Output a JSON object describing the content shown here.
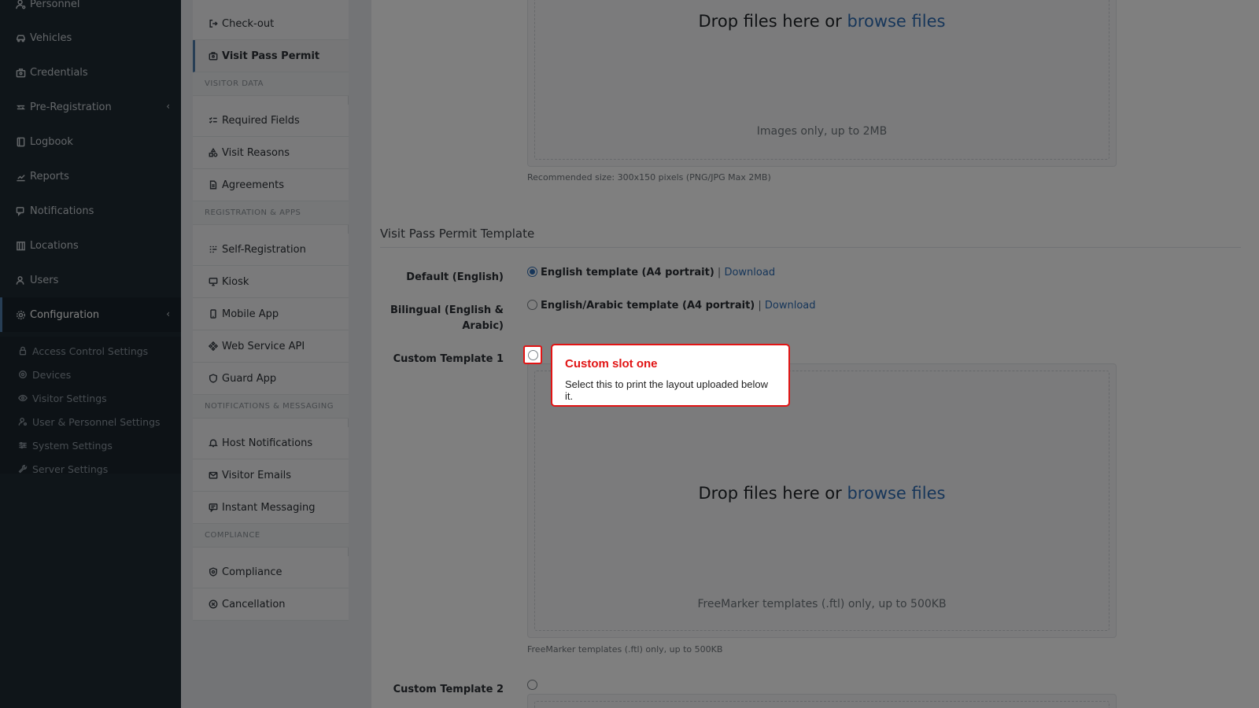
{
  "sidebar": {
    "items": [
      {
        "label": "Personnel",
        "icon": "user-cog-icon"
      },
      {
        "label": "Vehicles",
        "icon": "car-icon"
      },
      {
        "label": "Credentials",
        "icon": "id-card-icon"
      },
      {
        "label": "Pre-Registration",
        "icon": "arrows-icon"
      },
      {
        "label": "Logbook",
        "icon": "book-icon"
      },
      {
        "label": "Reports",
        "icon": "chart-icon"
      },
      {
        "label": "Notifications",
        "icon": "chat-icon"
      },
      {
        "label": "Locations",
        "icon": "building-icon"
      },
      {
        "label": "Users",
        "icon": "users-icon"
      },
      {
        "label": "Configuration",
        "icon": "gear-icon"
      }
    ],
    "config_sub": [
      {
        "label": "Access Control Settings",
        "icon": "lock-icon"
      },
      {
        "label": "Devices",
        "icon": "devices-icon"
      },
      {
        "label": "Visitor Settings",
        "icon": "eye-icon"
      },
      {
        "label": "User & Personnel Settings",
        "icon": "user-settings-icon"
      },
      {
        "label": "System Settings",
        "icon": "sliders-icon"
      },
      {
        "label": "Server Settings",
        "icon": "wrench-icon"
      }
    ]
  },
  "subnav": {
    "top_items": [
      {
        "label": "Check-out",
        "icon": "sign-out-icon"
      },
      {
        "label": "Visit Pass Permit",
        "icon": "id-badge-icon"
      }
    ],
    "sections": [
      {
        "title": "VISITOR DATA",
        "items": [
          {
            "label": "Required Fields",
            "icon": "checklist-icon"
          },
          {
            "label": "Visit Reasons",
            "icon": "shapes-icon"
          },
          {
            "label": "Agreements",
            "icon": "document-icon"
          }
        ]
      },
      {
        "title": "REGISTRATION & APPS",
        "items": [
          {
            "label": "Self-Registration",
            "icon": "grid-icon"
          },
          {
            "label": "Kiosk",
            "icon": "monitor-icon"
          },
          {
            "label": "Mobile App",
            "icon": "phone-icon"
          },
          {
            "label": "Web Service API",
            "icon": "api-icon"
          },
          {
            "label": "Guard App",
            "icon": "shield-icon"
          }
        ]
      },
      {
        "title": "NOTIFICATIONS & MESSAGING",
        "items": [
          {
            "label": "Host Notifications",
            "icon": "bell-icon"
          },
          {
            "label": "Visitor Emails",
            "icon": "mail-icon"
          },
          {
            "label": "Instant Messaging",
            "icon": "message-icon"
          }
        ]
      },
      {
        "title": "COMPLIANCE",
        "items": [
          {
            "label": "Compliance",
            "icon": "shield-check-icon"
          },
          {
            "label": "Cancellation",
            "icon": "cancel-icon"
          }
        ]
      }
    ]
  },
  "main": {
    "logo_drop": {
      "title_prefix": "Drop files here or ",
      "title_link": "browse files",
      "hint": "Images only, up to 2MB",
      "help": "Recommended size: 300x150 pixels (PNG/JPG Max 2MB)"
    },
    "section_title": "Visit Pass Permit Template",
    "options": [
      {
        "label": "Default (English)",
        "text": "English template (A4 portrait)",
        "separator": "|",
        "link": "Download",
        "checked": true
      },
      {
        "label_line1": "Bilingual (English &",
        "label_line2": "Arabic)",
        "text": "English/Arabic template (A4 portrait)",
        "separator": "|",
        "link": "Download",
        "checked": false
      }
    ],
    "custom1": {
      "label": "Custom Template 1",
      "drop_title_prefix": "Drop files here or ",
      "drop_title_link": "browse files",
      "drop_hint": "FreeMarker templates (.ftl) only, up to 500KB",
      "help": "FreeMarker templates (.ftl) only, up to 500KB"
    },
    "custom2": {
      "label": "Custom Template 2"
    }
  },
  "tooltip": {
    "title": "Custom slot one",
    "body": "Select this to print the layout uploaded below it."
  },
  "colors": {
    "accent": "#2e6db4",
    "highlight": "#e11414",
    "sidebar_bg": "#1e2a33"
  }
}
